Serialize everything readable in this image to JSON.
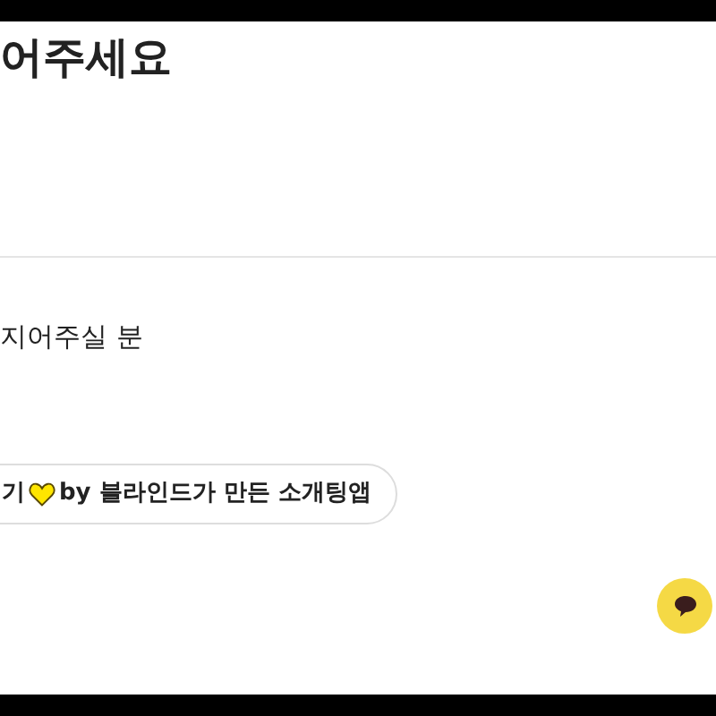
{
  "heading": "어주세요",
  "subtitle": "지어주실 분",
  "banner": {
    "lead": "기",
    "text": "by 블라인드가 만든 소개팅앱"
  }
}
